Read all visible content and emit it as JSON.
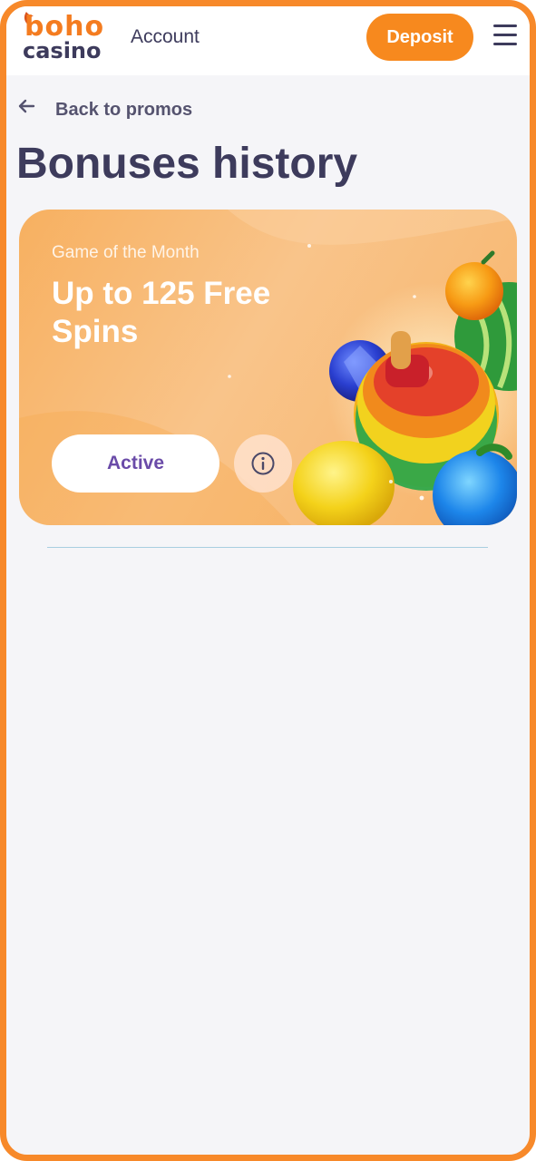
{
  "header": {
    "logo_top": "boho",
    "logo_bottom": "casino",
    "account_label": "Account",
    "deposit_label": "Deposit",
    "menu_icon": "hamburger-menu-icon"
  },
  "nav": {
    "back_label": "Back to promos",
    "back_icon": "arrow-left-icon"
  },
  "page": {
    "title": "Bonuses history"
  },
  "promo": {
    "subtitle": "Game of the Month",
    "title": "Up to 125 Free Spins",
    "status_label": "Active",
    "info_icon": "info-icon",
    "artwork": "fruit-slot-artwork"
  },
  "colors": {
    "brand_orange": "#f7892a",
    "deposit_button": "#f7891e",
    "text_dark": "#3d3b5c",
    "status_text": "#6a4ba8",
    "page_background": "#f5f5f8"
  }
}
